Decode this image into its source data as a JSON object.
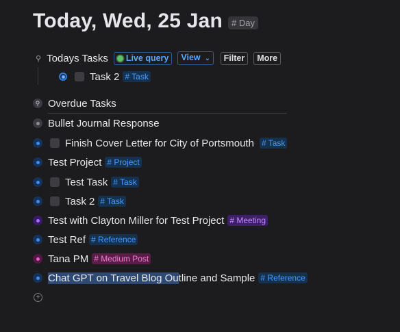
{
  "header": {
    "title": "Today, Wed, 25 Jan",
    "tag": "# Day"
  },
  "todays_tasks": {
    "label": "Todays Tasks",
    "live_query": "Live query",
    "view": "View",
    "filter": "Filter",
    "more": "More",
    "items": [
      {
        "label": "Task 2",
        "tag": "# Task"
      }
    ]
  },
  "overdue": {
    "label": "Overdue Tasks"
  },
  "nodes": [
    {
      "label": "Bullet Journal Response"
    },
    {
      "label": "Finish Cover Letter for City of Portsmouth",
      "tag": "# Task"
    },
    {
      "label": "Test Project",
      "tag": "# Project"
    },
    {
      "label": "Test Task",
      "tag": "# Task"
    },
    {
      "label": "Task 2",
      "tag": "# Task"
    },
    {
      "label": "Test with Clayton Miller for Test Project",
      "tag": "# Meeting"
    },
    {
      "label": "Test Ref",
      "tag": "# Reference"
    },
    {
      "label": "Tana PM",
      "tag": "# Medium Post"
    },
    {
      "label_selected": "Chat GPT on Travel Blog Ou",
      "label_rest": "tline and Sample",
      "tag": "# Reference"
    }
  ],
  "colors": {
    "task": "#2f7de1",
    "meeting": "#9b4dff",
    "medium": "#e04ab4",
    "plain": "#7a7a80"
  },
  "icons": {
    "add": "plus-circle-icon",
    "query": "search-icon"
  }
}
